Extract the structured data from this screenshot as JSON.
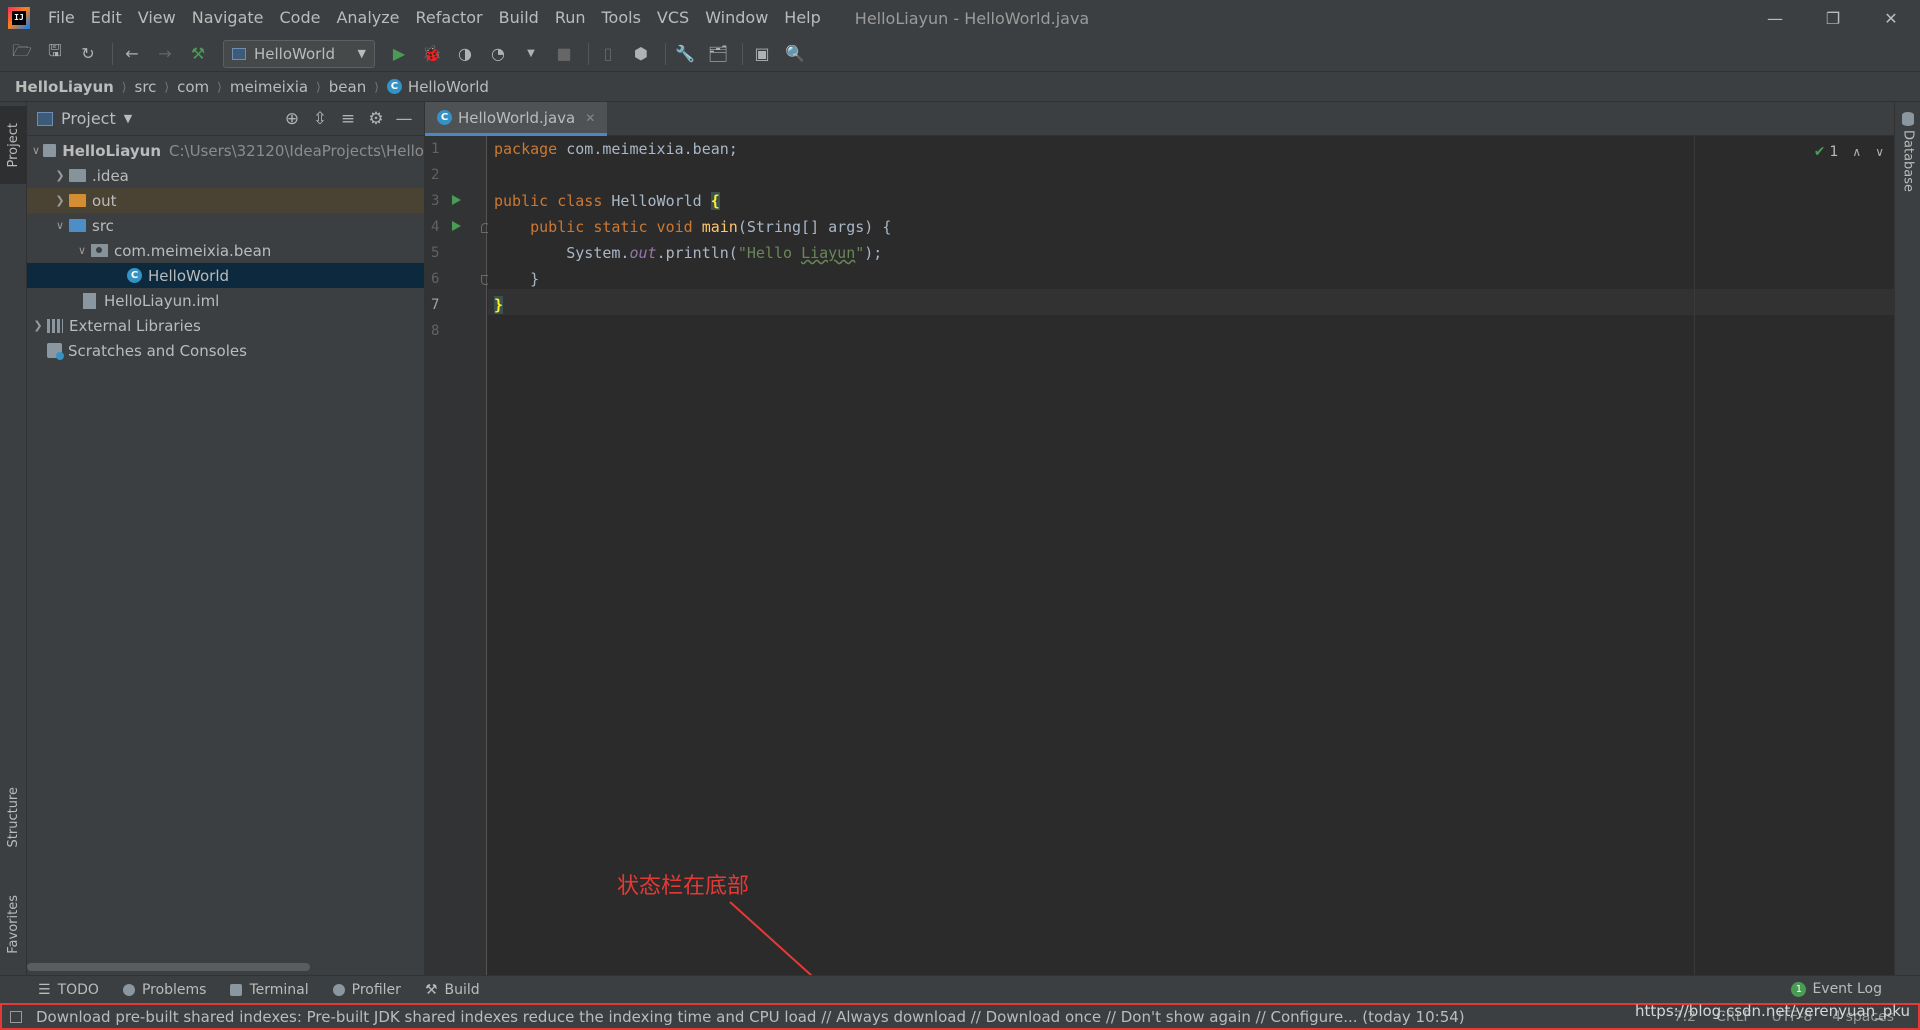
{
  "menu": {
    "items": [
      "File",
      "Edit",
      "View",
      "Navigate",
      "Code",
      "Analyze",
      "Refactor",
      "Build",
      "Run",
      "Tools",
      "VCS",
      "Window",
      "Help"
    ],
    "window_title": "HelloLiayun - HelloWorld.java"
  },
  "toolbar": {
    "run_config": "HelloWorld"
  },
  "breadcrumb": [
    "HelloLiayun",
    "src",
    "com",
    "meimeixia",
    "bean",
    "HelloWorld"
  ],
  "left_strip": {
    "project_tab": "Project",
    "structure_tab": "Structure",
    "favorites_tab": "Favorites"
  },
  "project_panel": {
    "title": "Project",
    "tree": {
      "root_name": "HelloLiayun",
      "root_path": "C:\\Users\\32120\\IdeaProjects\\Hello",
      "idea": ".idea",
      "out": "out",
      "src": "src",
      "package": "com.meimeixia.bean",
      "class": "HelloWorld",
      "iml": "HelloLiayun.iml",
      "external_libraries": "External Libraries",
      "scratches": "Scratches and Consoles"
    }
  },
  "editor": {
    "tab_label": "HelloWorld.java",
    "line_numbers": [
      "1",
      "2",
      "3",
      "4",
      "5",
      "6",
      "7",
      "8"
    ],
    "inspection_count": "1"
  },
  "right_strip": {
    "database_tab": "Database"
  },
  "annotation": {
    "text": "状态栏在底部",
    "color": "#e53935"
  },
  "bottom_tabs": {
    "todo": "TODO",
    "problems": "Problems",
    "terminal": "Terminal",
    "profiler": "Profiler",
    "build": "Build",
    "event_log": "Event Log",
    "event_count": "1"
  },
  "status_bar": {
    "message": "Download pre-built shared indexes: Pre-built JDK shared indexes reduce the indexing time and CPU load // Always download // Download once // Don't show again // Configure... (today 10:54)",
    "caret_position": "7:2",
    "line_separator": "CRLF",
    "encoding": "UTF-8",
    "indent": "4 spaces"
  },
  "watermark": "https://blog.csdn.net/yerenyuan_pku"
}
